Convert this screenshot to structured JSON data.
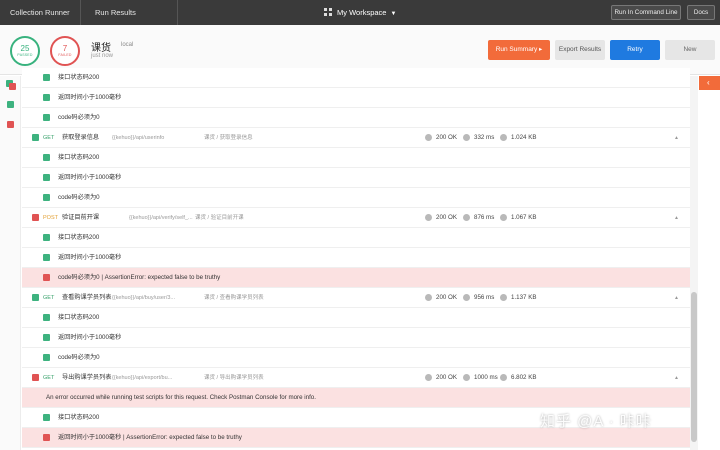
{
  "topbar": {
    "tab1": "Collection Runner",
    "tab2": "Run Results",
    "workspace": "My Workspace",
    "run_cmd": "Run In Command Line",
    "docs": "Docs"
  },
  "summary": {
    "passed_count": "25",
    "passed_label": "PASSED",
    "failed_count": "7",
    "failed_label": "FAILED",
    "collection": "课货",
    "environment": "local",
    "time": "just now",
    "run_summary": "Run Summary",
    "export": "Export Results",
    "retry": "Retry",
    "new": "New"
  },
  "colors": {
    "pass": "#3db27f",
    "fail": "#e05353",
    "accent": "#f26b3a",
    "primary": "#1f7ae0"
  },
  "rows": [
    {
      "kind": "test",
      "status": "pass",
      "name": "接口状态码200"
    },
    {
      "kind": "test",
      "status": "pass",
      "name": "返回时间小于1000毫秒"
    },
    {
      "kind": "test",
      "status": "pass",
      "name": "code码必须为0"
    },
    {
      "kind": "req",
      "status": "pass",
      "method": "GET",
      "name": "获取登录信息",
      "url": "{{kehuo}}/api/userinfo",
      "path": "课货 / 获取登录信息",
      "code": "200 OK",
      "time": "332 ms",
      "size": "1.024 KB"
    },
    {
      "kind": "test",
      "status": "pass",
      "name": "接口状态码200"
    },
    {
      "kind": "test",
      "status": "pass",
      "name": "返回时间小于1000毫秒"
    },
    {
      "kind": "test",
      "status": "pass",
      "name": "code码必须为0"
    },
    {
      "kind": "req",
      "status": "fail",
      "method": "POST",
      "name": "验证目前开课",
      "url": "{{kehuo}}/api/verify/self_...",
      "path": "课货 / 验证目前开课",
      "code": "200 OK",
      "time": "876 ms",
      "size": "1.067 KB"
    },
    {
      "kind": "test",
      "status": "pass",
      "name": "接口状态码200"
    },
    {
      "kind": "test",
      "status": "pass",
      "name": "返回时间小于1000毫秒"
    },
    {
      "kind": "test",
      "status": "fail",
      "name": "code码必须为0 | AssertionError: expected false to be truthy"
    },
    {
      "kind": "req",
      "status": "pass",
      "method": "GET",
      "name": "查看购课学员列表",
      "url": "{{kehuo}}/api/buy/user/3...",
      "path": "课货 / 查看购课学员列表",
      "code": "200 OK",
      "time": "956 ms",
      "size": "1.137 KB"
    },
    {
      "kind": "test",
      "status": "pass",
      "name": "接口状态码200"
    },
    {
      "kind": "test",
      "status": "pass",
      "name": "返回时间小于1000毫秒"
    },
    {
      "kind": "test",
      "status": "pass",
      "name": "code码必须为0"
    },
    {
      "kind": "req",
      "status": "fail",
      "method": "GET",
      "name": "导出购课学员列表",
      "url": "{{kehuo}}/api/export/bu...",
      "path": "课货 / 导出购课学员列表",
      "code": "200 OK",
      "time": "1000 ms",
      "size": "6.802 KB"
    },
    {
      "kind": "error",
      "text": "An error occurred while running test scripts for this request. Check Postman Console for more info."
    },
    {
      "kind": "test",
      "status": "pass",
      "name": "接口状态码200"
    },
    {
      "kind": "test",
      "status": "fail",
      "name": "返回时间小于1000毫秒 | AssertionError: expected false to be truthy"
    }
  ],
  "watermark": "知乎 @A · 咔咔"
}
